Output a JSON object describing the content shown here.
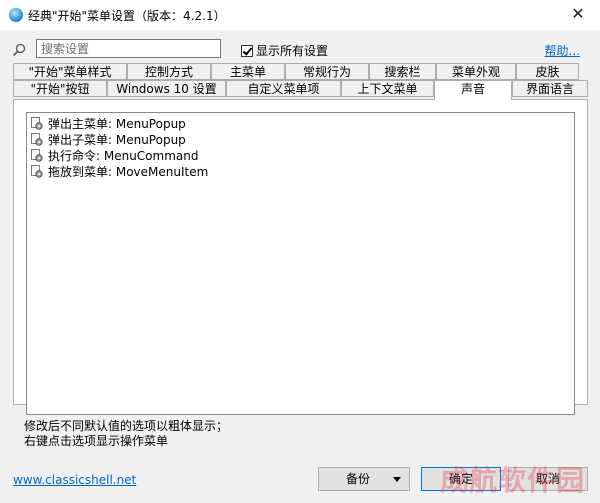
{
  "window": {
    "title": "经典\"开始\"菜单设置（版本：4.2.1）",
    "close_glyph": "✕"
  },
  "search": {
    "placeholder": "搜索设置",
    "value": ""
  },
  "show_all": {
    "label": "显示所有设置",
    "checked": true
  },
  "help_link": "帮助...",
  "tabs_row1": [
    "\"开始\"菜单样式",
    "控制方式",
    "主菜单",
    "常规行为",
    "搜索栏",
    "菜单外观",
    "皮肤"
  ],
  "tabs_row2": [
    "\"开始\"按钮",
    "Windows 10 设置",
    "自定义菜单项",
    "上下文菜单",
    "声音",
    "界面语言"
  ],
  "active_tab": "声音",
  "tree_items": [
    "弹出主菜单: MenuPopup",
    "弹出子菜单: MenuPopup",
    "执行命令: MenuCommand",
    "拖放到菜单: MoveMenuItem"
  ],
  "notes": {
    "line1": "修改后不同默认值的选项以粗体显示；",
    "line2": "右键点击选项显示操作菜单"
  },
  "footer_link": "www.classicshell.net",
  "buttons": {
    "backup": "备份",
    "ok": "确定",
    "cancel": "取消"
  },
  "watermark": "成航软件园",
  "colors": {
    "link": "#0066cc",
    "accent": "#0078d7"
  }
}
